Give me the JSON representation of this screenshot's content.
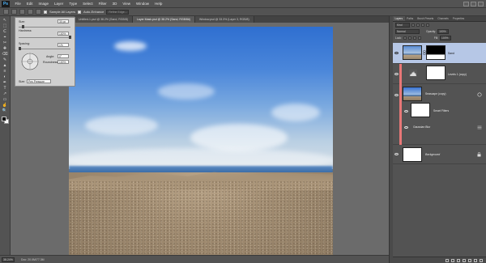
{
  "app": {
    "logo": "Ps"
  },
  "menu": [
    "File",
    "Edit",
    "Image",
    "Layer",
    "Type",
    "Select",
    "Filter",
    "3D",
    "View",
    "Window",
    "Help"
  ],
  "options_bar": {
    "sample_all_layers": "Sample All Layers",
    "auto_enhance": "Auto-Enhance",
    "refine_edge": "Refine Edge..."
  },
  "tabs": [
    {
      "label": "Untitled-1.psd @ 38.2% (Sand, RGB/8)",
      "active": false
    },
    {
      "label": "Layer Mask.psd @ 38.2% (Sand, RGB/8#)",
      "active": true
    },
    {
      "label": "Window.psd @ 33.3% (Layer 3, RGB/8)",
      "active": false
    }
  ],
  "tools": [
    "↖",
    "⬚",
    "ᑕ",
    "⌖",
    "✂",
    "✚",
    "⌫",
    "✎",
    "▲",
    "≡",
    "◐",
    "✒",
    "T",
    "↗",
    "▭",
    "☝",
    "🔍"
  ],
  "brush_popup": {
    "size_label": "Size:",
    "size_value": "30 px",
    "hardness_label": "Hardness:",
    "hardness_value": "100%",
    "spacing_label": "Spacing:",
    "spacing_value": "1%",
    "angle_label": "Angle:",
    "angle_value": "0°",
    "roundness_label": "Roundness:",
    "roundness_value": "100%",
    "pen_label": "Size:",
    "pen_value": "Pen Pressure"
  },
  "status": {
    "zoom": "38.24%",
    "doc": "Doc: 20.0M/77.3M"
  },
  "layers_panel": {
    "tabs": [
      {
        "label": "Layers",
        "active": true
      },
      {
        "label": "Paths",
        "active": false
      },
      {
        "label": "Brush Presets",
        "active": false
      },
      {
        "label": "Channels",
        "active": false
      },
      {
        "label": "Properties",
        "active": false
      }
    ],
    "kind": "Kind",
    "blend_mode": "Normal",
    "opacity_label": "Opacity:",
    "opacity_value": "100%",
    "lock_label": "Lock:",
    "fill_label": "Fill:",
    "fill_value": "100%",
    "layers": [
      {
        "name": "Sand",
        "selected": true
      },
      {
        "name": "Levels 1 (copy) ",
        "selected": false
      },
      {
        "name": "Seascape (copy)",
        "selected": false
      },
      {
        "name": "Smart Filters",
        "selected": false
      },
      {
        "name": "Gaussian Blur",
        "selected": false
      },
      {
        "name": "Background",
        "selected": false
      }
    ]
  }
}
